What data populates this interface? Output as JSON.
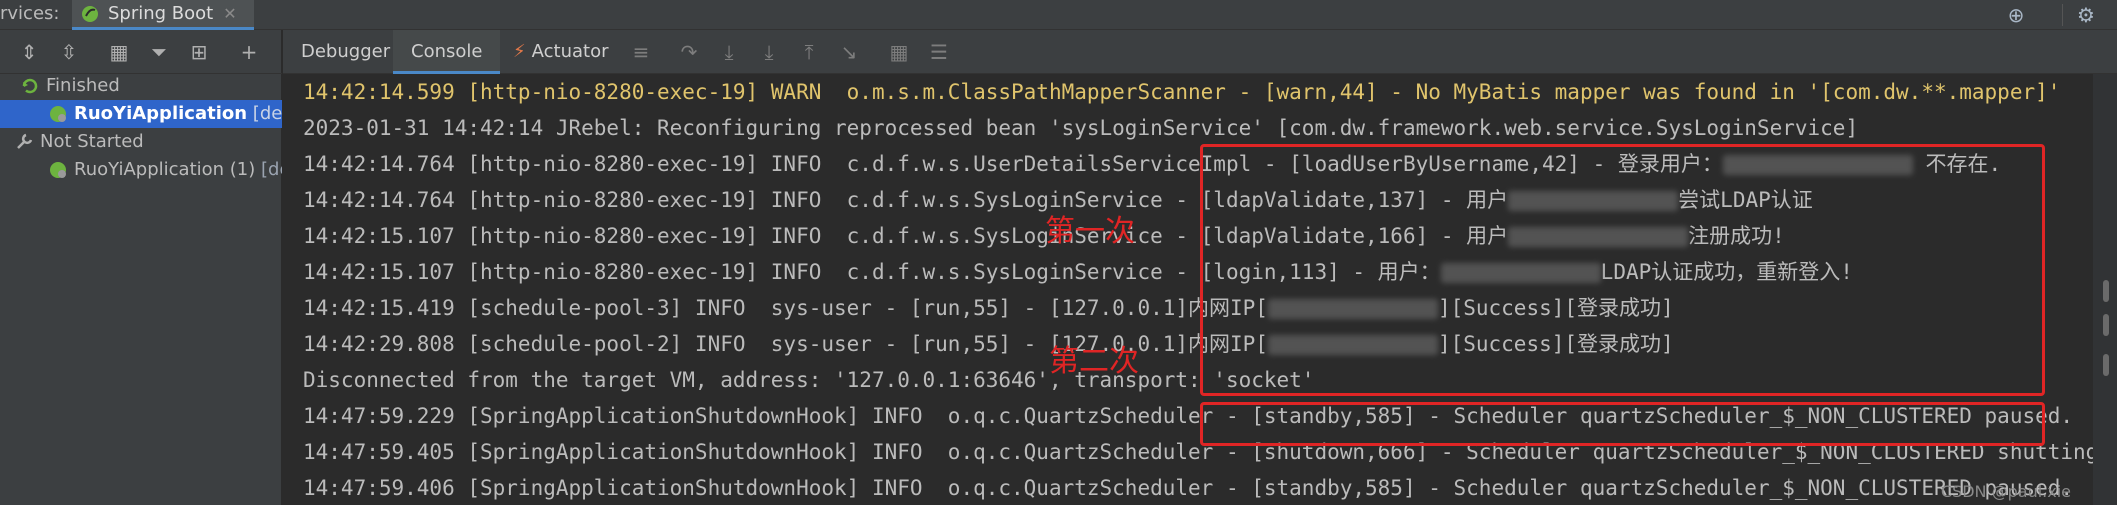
{
  "top": {
    "services_label": "rvices:",
    "tab_label": "Spring Boot",
    "tab_close": "✕",
    "icons": [
      "crosshair-icon",
      "gear-icon"
    ]
  },
  "left": {
    "toolbar": [
      "expand-all-icon",
      "collapse-all-icon",
      "group-icon",
      "filter-icon",
      "layout-icon",
      "add-icon"
    ],
    "tree": [
      {
        "label": "Finished",
        "detail": "",
        "selected": false
      },
      {
        "label": "RuoYiApplication",
        "detail": "[devto",
        "selected": true
      },
      {
        "label": "Not Started",
        "detail": "",
        "selected": false
      },
      {
        "label": "RuoYiApplication (1)",
        "detail": "[de",
        "selected": false
      }
    ]
  },
  "console_tabs": {
    "debugger": "Debugger",
    "console": "Console",
    "actuator": "Actuator"
  },
  "console": {
    "lines": [
      {
        "pre": "14:42:14.599 [http-nio-8280-exec-19] WARN  o.m.s.m.ClassPathMapperScanner - [warn,44] - No MyBatis mapper was found in '[com.dw.**.mapper]'",
        "post": "",
        "warn": true
      },
      {
        "pre": "2023-01-31 14:42:14 JRebel: Reconfiguring reprocessed bean 'sysLoginService' [com.dw.framework.web.service.SysLoginService]",
        "post": "",
        "warn": false
      },
      {
        "pre": "14:42:14.764 [http-nio-8280-exec-19] INFO  c.d.f.w.s.UserDetailsServiceImpl - [loadUserByUsername,42] - 登录用户：",
        "post": " 不存在.",
        "warn": false
      },
      {
        "pre": "14:42:14.764 [http-nio-8280-exec-19] INFO  c.d.f.w.s.SysLoginService - [ldapValidate,137] - 用户",
        "post": "尝试LDAP认证",
        "warn": false
      },
      {
        "pre": "14:42:15.107 [http-nio-8280-exec-19] INFO  c.d.f.w.s.SysLoginService - [ldapValidate,166] - 用户",
        "post": "注册成功!",
        "warn": false
      },
      {
        "pre": "14:42:15.107 [http-nio-8280-exec-19] INFO  c.d.f.w.s.SysLoginService - [login,113] - 用户：",
        "post": "LDAP认证成功，重新登入!",
        "warn": false
      },
      {
        "pre": "14:42:15.419 [schedule-pool-3] INFO  sys-user - [run,55] - [127.0.0.1]内网IP[",
        "post": "][Success][登录成功]",
        "warn": false
      },
      {
        "pre": "14:42:29.808 [schedule-pool-2] INFO  sys-user - [run,55] - [127.0.0.1]内网IP[",
        "post": "][Success][登录成功]",
        "warn": false
      },
      {
        "pre": "Disconnected from the target VM, address: '127.0.0.1:63646', transport: 'socket'",
        "post": "",
        "warn": false
      },
      {
        "pre": "14:47:59.229 [SpringApplicationShutdownHook] INFO  o.q.c.QuartzScheduler - [standby,585] - Scheduler quartzScheduler_$_NON_CLUSTERED paused.",
        "post": "",
        "warn": false
      },
      {
        "pre": "14:47:59.405 [SpringApplicationShutdownHook] INFO  o.q.c.QuartzScheduler - [shutdown,666] - Scheduler quartzScheduler_$_NON_CLUSTERED shutting down.",
        "post": "",
        "warn": false
      },
      {
        "pre": "14:47:59.406 [SpringApplicationShutdownHook] INFO  o.q.c.QuartzScheduler - [standby,585] - Scheduler quartzScheduler_$_NON_CLUSTERED paused.",
        "post": "",
        "warn": false
      }
    ],
    "annotation_first": "第一次",
    "annotation_second": "第二次",
    "watermark": "CSDN @paul.xie"
  },
  "colors": {
    "annotation": "#e02525",
    "warn_text": "#e0c46c",
    "selection": "#2f65ca"
  }
}
